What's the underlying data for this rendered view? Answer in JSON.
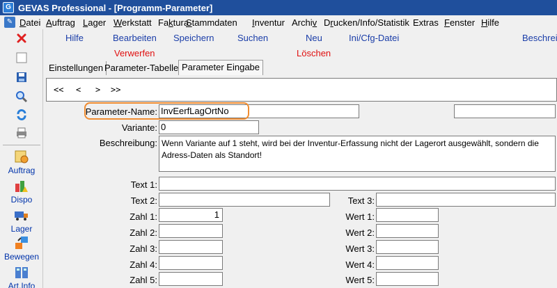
{
  "window": {
    "title": "GEVAS Professional - [Programm-Parameter]"
  },
  "menu": {
    "items": [
      {
        "pre": "",
        "u": "D",
        "post": "atei"
      },
      {
        "pre": "",
        "u": "A",
        "post": "uftrag"
      },
      {
        "pre": "",
        "u": "L",
        "post": "ager"
      },
      {
        "pre": "",
        "u": "W",
        "post": "erkstatt"
      },
      {
        "pre": "Fa",
        "u": "k",
        "post": "tura"
      },
      {
        "pre": "",
        "u": "S",
        "post": "tammdaten"
      },
      {
        "pre": "",
        "u": "I",
        "post": "nventur"
      },
      {
        "pre": "Archi",
        "u": "v",
        "post": ""
      },
      {
        "pre": "D",
        "u": "r",
        "post": "ucken/Info/Statistik"
      },
      {
        "pre": "",
        "u": "",
        "post": "Extras"
      },
      {
        "pre": "",
        "u": "F",
        "post": "enster"
      },
      {
        "pre": "",
        "u": "H",
        "post": "ilfe"
      }
    ]
  },
  "toolbar": {
    "hilfe": "Hilfe",
    "bearbeiten": "Bearbeiten",
    "speichern": "Speichern",
    "suchen": "Suchen",
    "neu": "Neu",
    "ini": "Ini/Cfg-Datei",
    "beschrei": "Beschrei",
    "verwerfen": "Verwerfen",
    "loeschen": "Löschen"
  },
  "sidebar": {
    "nav": [
      {
        "label": "Auftrag",
        "icon": "order-icon"
      },
      {
        "label": "Dispo",
        "icon": "dispo-icon"
      },
      {
        "label": "Lager",
        "icon": "truck-icon"
      },
      {
        "label": "Bewegen",
        "icon": "move-icon"
      },
      {
        "label": "Art.Info",
        "icon": "article-info-icon"
      }
    ]
  },
  "tabs": [
    "Einstellungen",
    "Parameter-Tabelle",
    "Parameter Eingabe"
  ],
  "navigator": {
    "first": "<<",
    "prev": "<",
    "next": ">",
    "last": ">>"
  },
  "form": {
    "parameter_name_label": "Parameter-Name:",
    "parameter_name_value": "InvEerfLagOrtNo",
    "variante_label": "Variante:",
    "variante_value": "0",
    "beschreibung_label": "Beschreibung:",
    "beschreibung_value": "Wenn Variante auf 1 steht, wird bei der Inventur-Erfassung nicht der Lagerort ausgewählt, sondern die Adress-Daten als Standort!",
    "text1_label": "Text 1:",
    "text2_label": "Text 2:",
    "text3_label": "Text 3:",
    "zahl1_label": "Zahl 1:",
    "zahl1_value": "1",
    "zahl2_label": "Zahl 2:",
    "zahl3_label": "Zahl 3:",
    "zahl4_label": "Zahl 4:",
    "zahl5_label": "Zahl 5:",
    "wert1_label": "Wert 1:",
    "wert2_label": "Wert 2:",
    "wert3_label": "Wert 3:",
    "wert4_label": "Wert 4:",
    "wert5_label": "Wert 5:"
  },
  "colors": {
    "titlebar": "#1f4f9c",
    "link_blue": "#1a3da8",
    "danger_red": "#e01010",
    "highlight": "#f08c30"
  }
}
